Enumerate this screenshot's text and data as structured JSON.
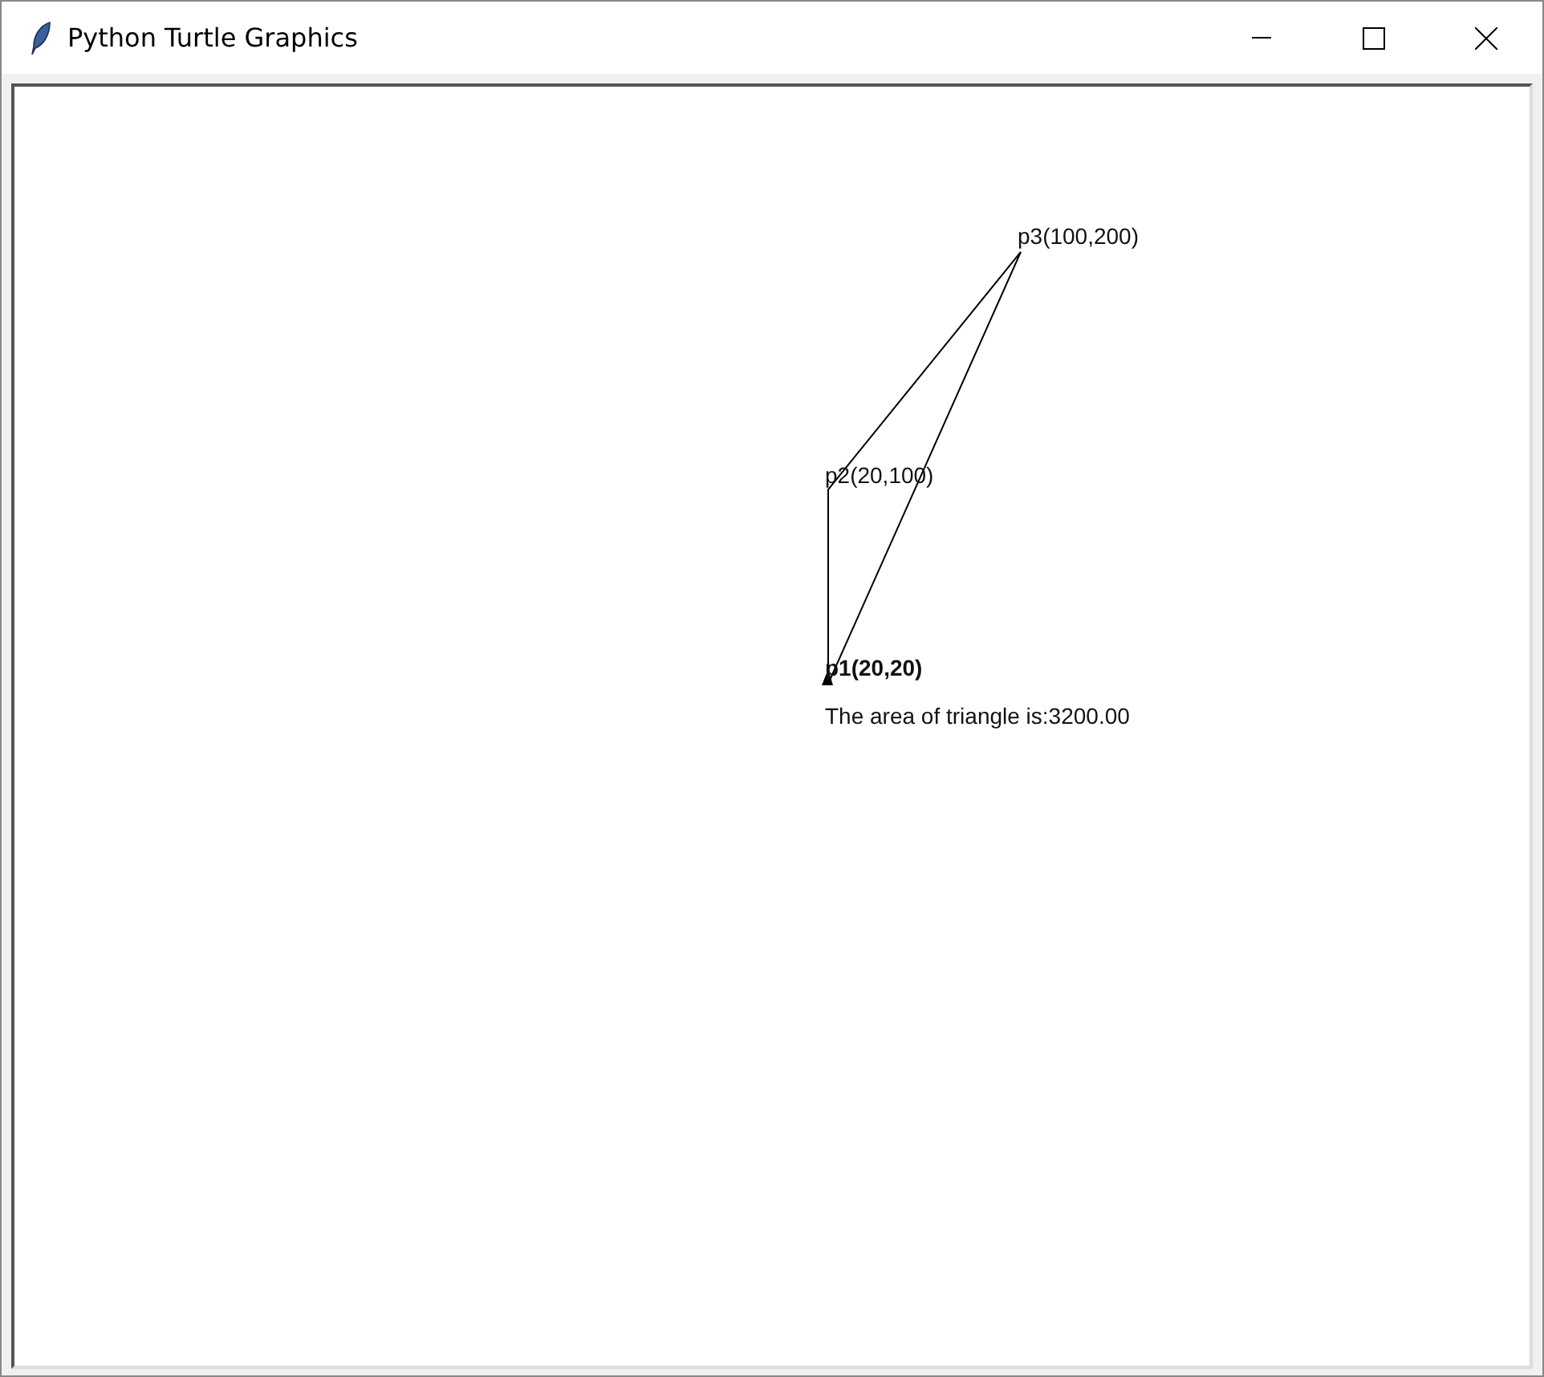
{
  "window": {
    "title": "Python Turtle Graphics"
  },
  "canvas": {
    "point_labels": [
      "p1(20,20)",
      "p2(20,100)",
      "p3(100,200)"
    ],
    "result_text": "The area of triangle is:3200.00"
  }
}
